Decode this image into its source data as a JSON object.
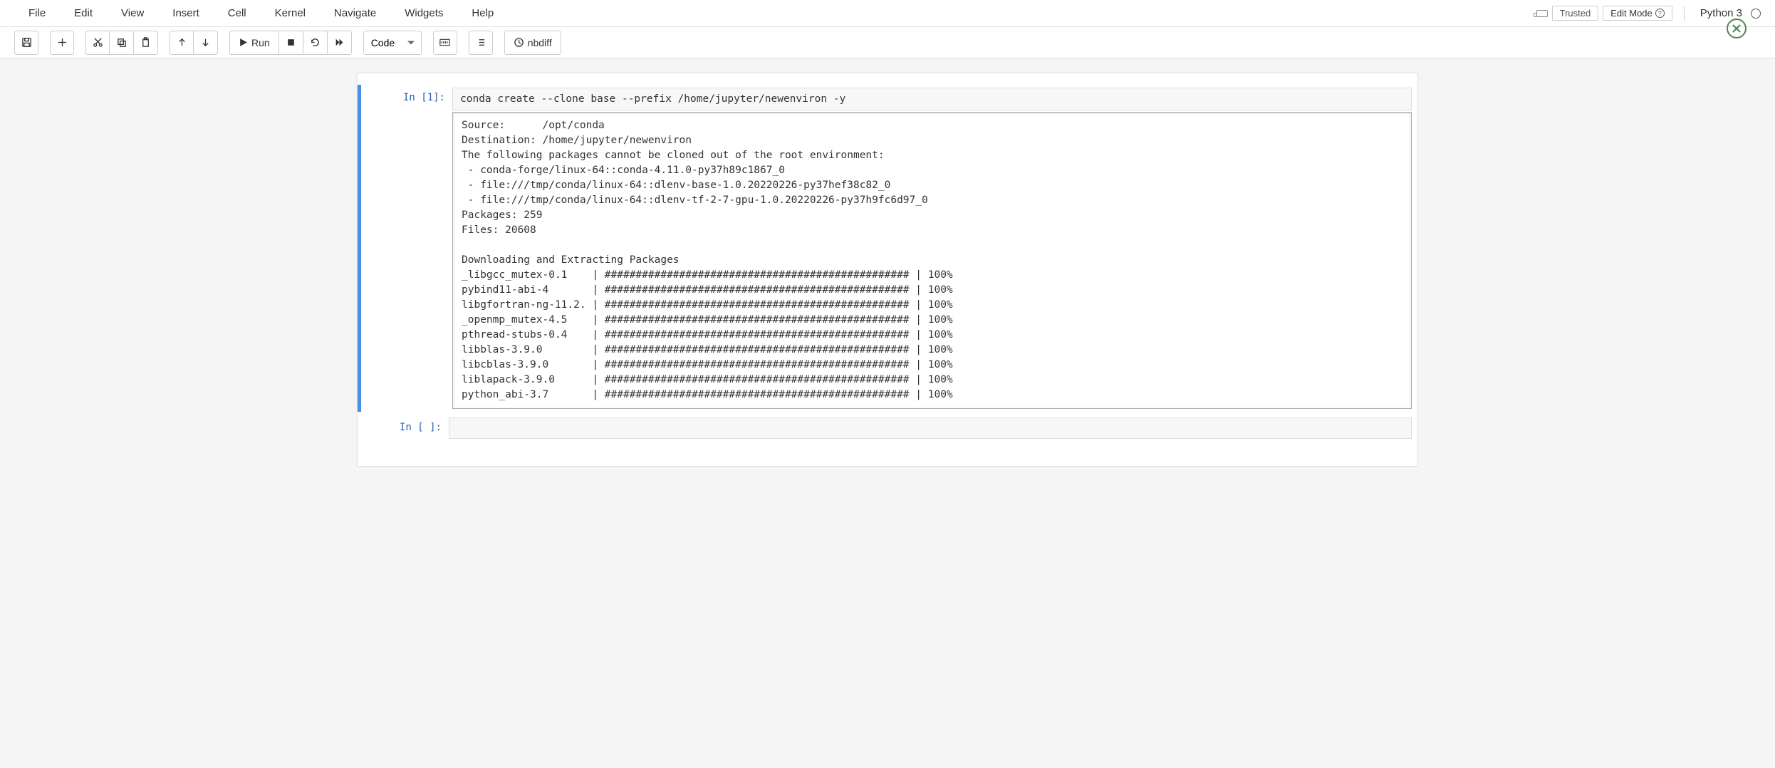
{
  "menubar": {
    "items": [
      "File",
      "Edit",
      "View",
      "Insert",
      "Cell",
      "Kernel",
      "Navigate",
      "Widgets",
      "Help"
    ]
  },
  "status": {
    "trusted": "Trusted",
    "edit_mode": "Edit Mode",
    "kernel": "Python 3"
  },
  "toolbar": {
    "run_label": "Run",
    "cell_type": "Code",
    "nbdiff_label": "nbdiff"
  },
  "cells": [
    {
      "prompt": "In [1]:",
      "code": "conda create --clone base --prefix /home/jupyter/newenviron -y",
      "output": "Source:      /opt/conda\nDestination: /home/jupyter/newenviron\nThe following packages cannot be cloned out of the root environment:\n - conda-forge/linux-64::conda-4.11.0-py37h89c1867_0\n - file:///tmp/conda/linux-64::dlenv-base-1.0.20220226-py37hef38c82_0\n - file:///tmp/conda/linux-64::dlenv-tf-2-7-gpu-1.0.20220226-py37h9fc6d97_0\nPackages: 259\nFiles: 20608\n\nDownloading and Extracting Packages\n_libgcc_mutex-0.1    | ################################################# | 100%\npybind11-abi-4       | ################################################# | 100%\nlibgfortran-ng-11.2. | ################################################# | 100%\n_openmp_mutex-4.5    | ################################################# | 100%\npthread-stubs-0.4    | ################################################# | 100%\nlibblas-3.9.0        | ################################################# | 100%\nlibcblas-3.9.0       | ################################################# | 100%\nliblapack-3.9.0      | ################################################# | 100%\npython_abi-3.7       | ################################################# | 100%"
    },
    {
      "prompt": "In [ ]:",
      "code": ""
    }
  ]
}
